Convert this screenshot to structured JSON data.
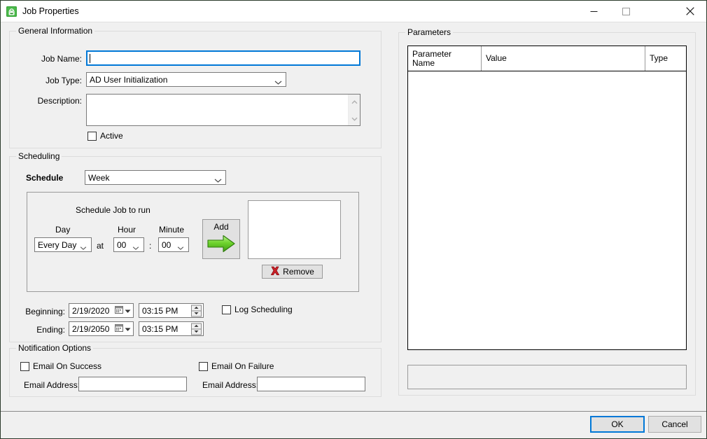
{
  "window": {
    "title": "Job Properties",
    "icon": "job-properties-icon",
    "controls": {
      "minimize": "minimize-icon",
      "maximize": "maximize-icon",
      "close": "close-icon"
    }
  },
  "general": {
    "legend": "General Information",
    "job_name_label": "Job Name:",
    "job_name_value": "",
    "job_type_label": "Job Type:",
    "job_type_value": "AD User Initialization",
    "description_label": "Description:",
    "description_value": "",
    "active_label": "Active",
    "active_checked": false
  },
  "scheduling": {
    "legend": "Scheduling",
    "schedule_label": "Schedule",
    "schedule_value": "Week",
    "inner_title": "Schedule Job to run",
    "day_label": "Day",
    "hour_label": "Hour",
    "minute_label": "Minute",
    "day_value": "Every Day",
    "at_label": "at",
    "hour_value": "00",
    "colon": ":",
    "minute_value": "00",
    "add_label": "Add",
    "remove_label": "Remove",
    "occurrences": [],
    "beginning_label": "Beginning:",
    "beginning_date": "2/19/2020",
    "beginning_time": "03:15 PM",
    "ending_label": "Ending:",
    "ending_date": "2/19/2050",
    "ending_time": "03:15 PM",
    "log_scheduling_label": "Log Scheduling",
    "log_scheduling_checked": false
  },
  "notification": {
    "legend": "Notification Options",
    "email_success_label": "Email On Success",
    "email_success_checked": false,
    "email_success_addr_label": "Email Address:",
    "email_success_addr_value": "",
    "email_failure_label": "Email On Failure",
    "email_failure_checked": false,
    "email_failure_addr_label": "Email Address:",
    "email_failure_addr_value": "",
    "email_placeholder": ""
  },
  "parameters": {
    "legend": "Parameters",
    "columns": [
      "Parameter\nName",
      "Value",
      "Type"
    ],
    "col_param_name_line1": "Parameter",
    "col_param_name_line2": "Name",
    "col_value": "Value",
    "col_type": "Type",
    "rows": [],
    "footer_text": ""
  },
  "footer": {
    "ok_label": "OK",
    "cancel_label": "Cancel"
  },
  "colors": {
    "accent": "#0078d7",
    "dialog_bg": "#f0f0f0",
    "field_bg": "#ffffff",
    "add_green": "#5fd025",
    "remove_red": "#c1272d"
  }
}
